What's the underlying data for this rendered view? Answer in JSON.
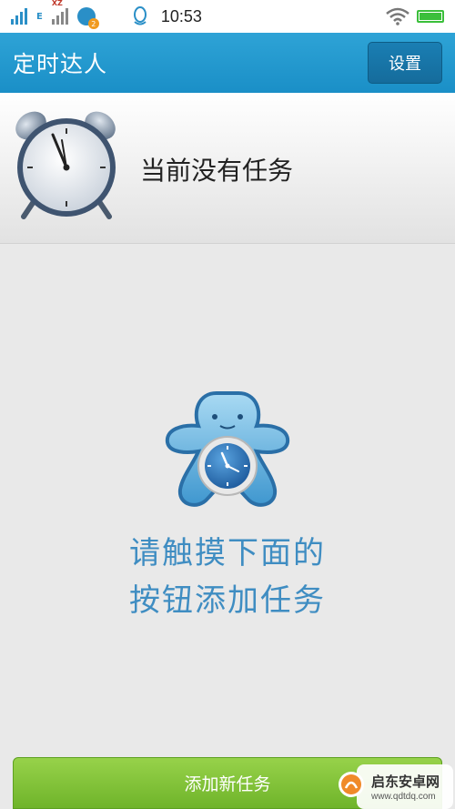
{
  "status_bar": {
    "network_tag": "E",
    "roaming_tag": "XZ",
    "notification_count": "2",
    "time": "10:53",
    "battery_level": 1.0
  },
  "app": {
    "title": "定时达人",
    "settings_label": "设置"
  },
  "current_task": {
    "empty_text": "当前没有任务"
  },
  "empty_state": {
    "hint_line1": "请触摸下面的",
    "hint_line2": "按钮添加任务"
  },
  "add_button": {
    "label": "添加新任务"
  },
  "watermark": {
    "title": "启东安卓网",
    "url": "www.qdtdq.com"
  },
  "colors": {
    "title_bar": "#1a8fc7",
    "hint_text": "#3f8dc2",
    "add_button": "#7dbe34"
  }
}
